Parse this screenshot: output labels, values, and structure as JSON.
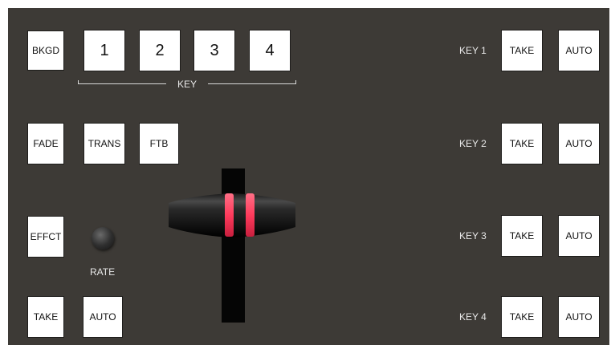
{
  "transition": {
    "bkgd_label": "BKGD",
    "key_buttons": [
      "1",
      "2",
      "3",
      "4"
    ],
    "key_group_label": "KEY",
    "fade_label": "FADE",
    "trans_label": "TRANS",
    "ftb_label": "FTB",
    "effct_label": "EFFCT",
    "rate_label": "RATE",
    "take_label": "TAKE",
    "auto_label": "AUTO"
  },
  "keyers": [
    {
      "label": "KEY 1",
      "take": "TAKE",
      "auto": "AUTO"
    },
    {
      "label": "KEY 2",
      "take": "TAKE",
      "auto": "AUTO"
    },
    {
      "label": "KEY 3",
      "take": "TAKE",
      "auto": "AUTO"
    },
    {
      "label": "KEY 4",
      "take": "TAKE",
      "auto": "AUTO"
    }
  ],
  "colors": {
    "panel": "#3d3a36",
    "button": "#ffffff",
    "tbar_indicator": "#ff3b5c"
  }
}
